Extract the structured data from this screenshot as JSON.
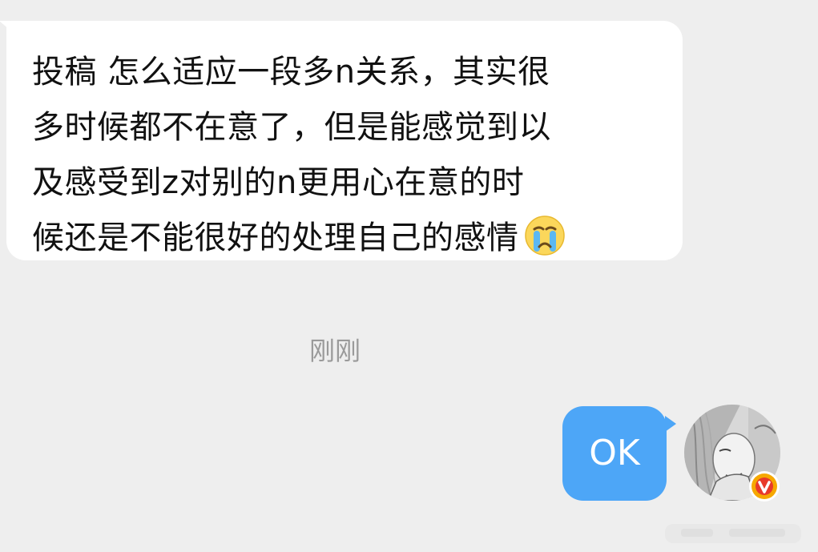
{
  "incoming_message": {
    "lines": [
      "投稿 怎么适应一段多n关系，其实很",
      "多时候都不在意了，但是能感觉到以",
      "及感受到z对别的n更用心在意的时",
      "候还是不能很好的处理自己的感情"
    ],
    "emoji": "crying-face-emoji"
  },
  "timestamp": "刚刚",
  "outgoing_message": {
    "text": "OK"
  },
  "avatar": {
    "icon": "user-avatar",
    "badge_icon": "verified-v-badge-icon"
  },
  "colors": {
    "background": "#eeeeee",
    "incoming_bubble": "#ffffff",
    "outgoing_bubble": "#4da6f7",
    "timestamp_text": "#9a9a9a",
    "badge": "#f6a800"
  }
}
